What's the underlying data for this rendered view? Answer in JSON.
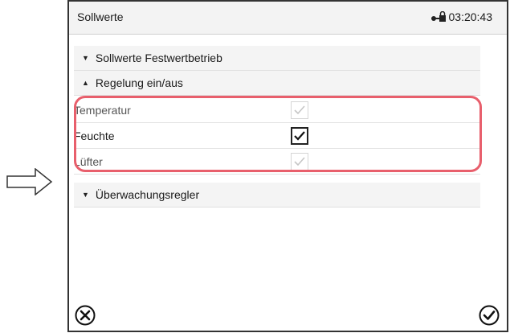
{
  "header": {
    "title": "Sollwerte",
    "time": "03:20:43"
  },
  "sections": {
    "festwert": "Sollwerte Festwertbetrieb",
    "regelung": "Regelung ein/aus",
    "ueberwachung": "Überwachungsregler"
  },
  "controls": {
    "temperatur": {
      "label": "Temperatur",
      "checked": true,
      "enabled": false
    },
    "feuchte": {
      "label": "Feuchte",
      "checked": true,
      "enabled": true
    },
    "luefter": {
      "label": "Lüfter",
      "checked": true,
      "enabled": false
    }
  },
  "icons": {
    "lock": "lock-icon",
    "cancel": "cancel-icon",
    "confirm": "confirm-icon",
    "pointer": "arrow-right-icon",
    "section_collapsed": "triangle-down-icon",
    "section_expanded": "triangle-up-icon"
  },
  "colors": {
    "highlight": "#e85f6c"
  }
}
